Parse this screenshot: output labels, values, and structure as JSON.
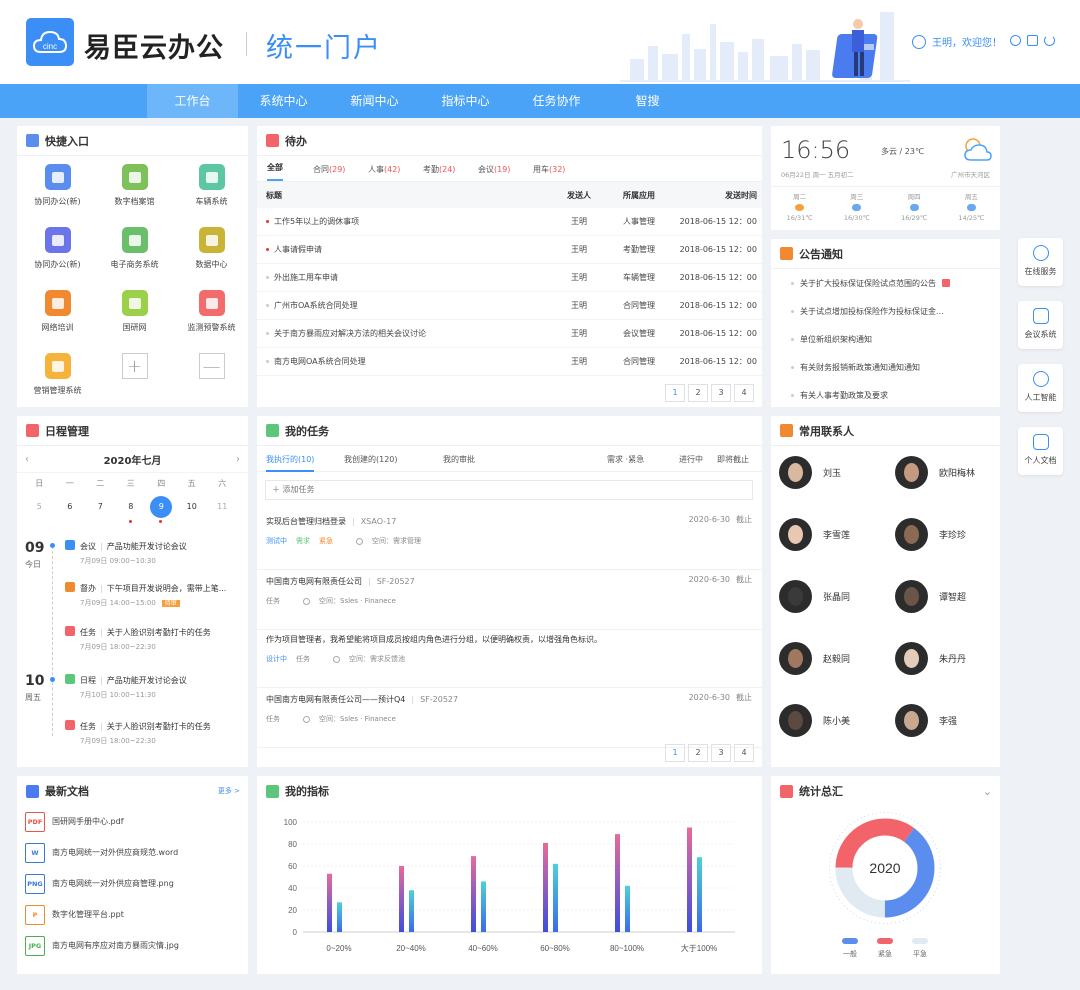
{
  "header": {
    "logo_text": "cinc",
    "brand": "易臣云办公",
    "portal": "统一门户",
    "user_greeting": "王明，欢迎您！"
  },
  "nav": [
    "工作台",
    "系统中心",
    "新闻中心",
    "指标中心",
    "任务协作",
    "智搜"
  ],
  "quick": {
    "title": "快捷入口",
    "items": [
      {
        "label": "协同办公(新)",
        "color": "#5b8def"
      },
      {
        "label": "数字档案馆",
        "color": "#7ec05a"
      },
      {
        "label": "车辆系统",
        "color": "#5cc7a2"
      },
      {
        "label": "协同办公(新)",
        "color": "#6b74e8"
      },
      {
        "label": "电子商务系统",
        "color": "#6bbf6a"
      },
      {
        "label": "数据中心",
        "color": "#c9b437"
      },
      {
        "label": "网络培训",
        "color": "#f0892f"
      },
      {
        "label": "国研网",
        "color": "#9ccf4a"
      },
      {
        "label": "监测预警系统",
        "color": "#f36b6b"
      },
      {
        "label": "营销管理系统",
        "color": "#f5b33c"
      }
    ]
  },
  "todo": {
    "title": "待办",
    "tabs": [
      {
        "label": "全部",
        "count": ""
      },
      {
        "label": "合同",
        "count": "(29)"
      },
      {
        "label": "人事",
        "count": "(42)"
      },
      {
        "label": "考勤",
        "count": "(24)"
      },
      {
        "label": "会议",
        "count": "(19)"
      },
      {
        "label": "用车",
        "count": "(32)"
      }
    ],
    "headers": [
      "标题",
      "发送人",
      "所属应用",
      "发送时间"
    ],
    "rows": [
      {
        "title": "工作5年以上的调休事项",
        "sender": "王明",
        "app": "人事管理",
        "time": "2018-06-15 12：00",
        "urgent": true
      },
      {
        "title": "人事请假申请",
        "sender": "王明",
        "app": "考勤管理",
        "time": "2018-06-15 12：00",
        "urgent": true
      },
      {
        "title": "外出施工用车申请",
        "sender": "王明",
        "app": "车辆管理",
        "time": "2018-06-15 12：00",
        "urgent": false
      },
      {
        "title": "广州市OA系统合同处理",
        "sender": "王明",
        "app": "合同管理",
        "time": "2018-06-15 12：00",
        "urgent": false
      },
      {
        "title": "关于南方暴雨应对解决方法的相关会议讨论",
        "sender": "王明",
        "app": "会议管理",
        "time": "2018-06-15 12：00",
        "urgent": false
      },
      {
        "title": "南方电网OA系统合同处理",
        "sender": "王明",
        "app": "合同管理",
        "time": "2018-06-15 12：00",
        "urgent": false
      }
    ],
    "pages": [
      "1",
      "2",
      "3",
      "4"
    ]
  },
  "weather": {
    "time": "16:56",
    "cond": "多云",
    "temp": "23℃",
    "date": "06月22日 周一 五月初二",
    "city": "广州市天河区",
    "forecast": [
      {
        "day": "周二",
        "temp": "16/31℃"
      },
      {
        "day": "周三",
        "temp": "16/30℃"
      },
      {
        "day": "周四",
        "temp": "16/29℃"
      },
      {
        "day": "周五",
        "temp": "14/25℃"
      }
    ]
  },
  "notice": {
    "title": "公告通知",
    "items": [
      "关于扩大投标保证保险试点范围的公告",
      "关于试点增加投标保险作为投标保证金...",
      "单位新组织架构通知",
      "有关财务报销新政策通知通知通知",
      "有关人事考勤政策及要求"
    ]
  },
  "side": [
    "在线服务",
    "会议系统",
    "人工智能",
    "个人文档"
  ],
  "schedule": {
    "title": "日程管理",
    "month": "2020年七月",
    "weekdays": [
      "日",
      "一",
      "二",
      "三",
      "四",
      "五",
      "六"
    ],
    "dates": [
      "5",
      "6",
      "7",
      "8",
      "9",
      "10",
      "11"
    ],
    "day1": {
      "num": "09",
      "label": "今日"
    },
    "day2": {
      "num": "10",
      "label": "周五"
    },
    "events": [
      {
        "type": "会议",
        "title": "产品功能开发讨论会议",
        "time": "7月09日 09:00~10:30"
      },
      {
        "type": "督办",
        "title": "下午项目开发说明会，需带上笔...",
        "time": "7月09日 14:00~15:00",
        "badge": "待审"
      },
      {
        "type": "任务",
        "title": "关于人脸识别考勤打卡的任务",
        "time": "7月09日 18:00~22:30"
      },
      {
        "type": "日程",
        "title": "产品功能开发讨论会议",
        "time": "7月10日 10:00~11:30"
      },
      {
        "type": "任务",
        "title": "关于人脸识别考勤打卡的任务",
        "time": "7月09日 18:00~22:30"
      }
    ]
  },
  "tasks": {
    "title": "我的任务",
    "tabs": [
      "我执行的(10)",
      "我创建的(120)",
      "我的审批"
    ],
    "filters": [
      "需求 ·紧急",
      "进行中",
      "即将截止"
    ],
    "add": "添加任务",
    "items": [
      {
        "title": "实现后台管理归档登录",
        "code": "XSAO-17",
        "date": "2020-6-30",
        "due": "截止",
        "tags": [
          "测试中",
          "需求",
          "紧急"
        ],
        "space": "空间：需求管理"
      },
      {
        "title": "中国南方电网有限责任公司",
        "code": "SF-20527",
        "date": "2020-6-30",
        "due": "截止",
        "tags": [
          "任务"
        ],
        "space": "空间：Ssles · Finanece"
      },
      {
        "title": "作为项目管理者，我希望能将项目成员按组内角色进行分组，以便明确权责，以增强角色标识。",
        "code": "",
        "date": "",
        "due": "",
        "tags": [
          "设计中",
          "任务"
        ],
        "space": "空间：需求反馈池"
      },
      {
        "title": "中国南方电网有限责任公司——预计Q4",
        "code": "SF-20527",
        "date": "2020-6-30",
        "due": "截止",
        "tags": [
          "任务"
        ],
        "space": "空间：Ssles · Finanece"
      }
    ],
    "pages": [
      "1",
      "2",
      "3",
      "4"
    ]
  },
  "contacts": {
    "title": "常用联系人",
    "items": [
      "刘玉",
      "欧阳梅林",
      "李雪莲",
      "李珍珍",
      "张晶同",
      "谭智超",
      "赵毅同",
      "朱丹丹",
      "陈小美",
      "李强"
    ]
  },
  "docs": {
    "title": "最新文档",
    "more": "更多 >",
    "items": [
      {
        "type": "PDF",
        "name": "国研网手册中心.pdf",
        "color": "#e8564a"
      },
      {
        "type": "W",
        "name": "南方电网统一对外供应商规范.word",
        "color": "#3a7bd5"
      },
      {
        "type": "PNG",
        "name": "南方电网统一对外供应商管理.png",
        "color": "#3a7bd5"
      },
      {
        "type": "P",
        "name": "数字化管理平台.ppt",
        "color": "#f08c2e"
      },
      {
        "type": "JPG",
        "name": "南方电网有序应对南方暴雨灾情.jpg",
        "color": "#4bae4f"
      }
    ]
  },
  "metrics": {
    "title": "我的指标"
  },
  "chart_data": {
    "type": "bar",
    "categories": [
      "0~20%",
      "20~40%",
      "40~60%",
      "60~80%",
      "80~100%",
      "大于100%"
    ],
    "series": [
      {
        "values": [
          53,
          60,
          69,
          81,
          89,
          95
        ],
        "color": "#6b5ce8"
      },
      {
        "values": [
          27,
          38,
          46,
          62,
          42,
          68
        ],
        "color": "#3ab5d9"
      }
    ],
    "yticks": [
      "0",
      "20",
      "40",
      "60",
      "80",
      "100"
    ],
    "ylim": [
      0,
      100
    ]
  },
  "stats": {
    "title": "统计总汇",
    "center": "2020",
    "legend": [
      {
        "label": "一般",
        "color": "#5b8def"
      },
      {
        "label": "紧急",
        "color": "#f2646a"
      },
      {
        "label": "平急",
        "color": "#dfeaf2"
      }
    ],
    "segments": [
      40,
      35,
      25
    ]
  }
}
